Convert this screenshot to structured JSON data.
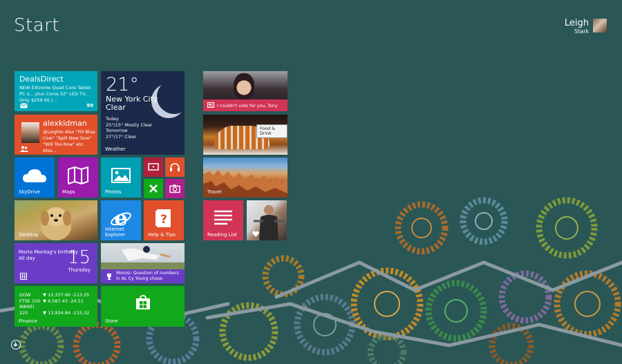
{
  "screen": {
    "title": "Start"
  },
  "user": {
    "first": "Leigh",
    "last": "Stark"
  },
  "colors": {
    "background": "#2a5656",
    "accent_teal": "#00a6b8",
    "accent_orange": "#e1502b",
    "accent_purple": "#9b1bad",
    "accent_green": "#11a81b",
    "accent_pink": "#d13455"
  },
  "tiles": {
    "deals": {
      "title": "DealsDirect",
      "text": "NEW EXtreme Quad Core Tablet PC u... plus Conia 32\" LED TV, Only $259.95 |...",
      "badge": "99",
      "icon": "mail-icon"
    },
    "weather": {
      "temp": "21°",
      "city_line1": "New York City",
      "city_line2": "Clear",
      "today_label": "Today",
      "today_forecast": "25°/15° Mostly Clear",
      "tomorrow_label": "Tomorrow",
      "tomorrow_forecast": "27°/17° Clear",
      "label": "Weather"
    },
    "social": {
      "name": "alexkidman",
      "message": "@Leighlo Also \"Fill Blue Cow\" \"Spill New Sow\" \"Will Too Row\" etc. Also...",
      "icon": "people-icon"
    },
    "skydrive": {
      "label": "SkyDrive",
      "icon": "cloud-icon"
    },
    "maps": {
      "label": "Maps",
      "icon": "map-icon"
    },
    "photos": {
      "label": "Photos",
      "icon": "photo-icon"
    },
    "small_video": {
      "icon": "video-icon"
    },
    "small_music": {
      "icon": "headphones-icon"
    },
    "small_games": {
      "icon": "gamepad-icon"
    },
    "small_camera": {
      "icon": "camera-icon"
    },
    "desktop": {
      "label": "Desktop"
    },
    "ie": {
      "label": "Internet Explorer",
      "icon": "ie-icon"
    },
    "help": {
      "label": "Help & Tips",
      "icon": "help-icon"
    },
    "calendar": {
      "event": "Marta Montag's birthday",
      "event_time": "All day",
      "day": "15",
      "weekday": "Thursday",
      "icon": "calendar-icon"
    },
    "sports": {
      "headline_line1": "Morosi: Question of numbers",
      "headline_line2": "in AL Cy Young chase",
      "icon": "trophy-icon"
    },
    "finance": {
      "label": "Finance",
      "rows": [
        {
          "name": "DOW",
          "value": "▼ 15,337.66 -113.35"
        },
        {
          "name": "FTSE 100",
          "value": "▼ 6,587.43 -24.51"
        },
        {
          "name": "NIKKEI 225",
          "value": "▼ 13,934.84 -115.32"
        }
      ]
    },
    "store": {
      "label": "Store",
      "icon": "store-icon"
    },
    "news": {
      "headline": "I couldn't vote for you, Tony",
      "icon": "news-icon"
    },
    "food": {
      "tooltip": "Food & Drink"
    },
    "travel": {
      "label": "Travel"
    },
    "reading": {
      "label": "Reading List",
      "icon": "reading-list-icon"
    },
    "fitness": {
      "icon": "heart-icon"
    }
  },
  "scroll": {
    "icon": "down-arrow-icon"
  }
}
